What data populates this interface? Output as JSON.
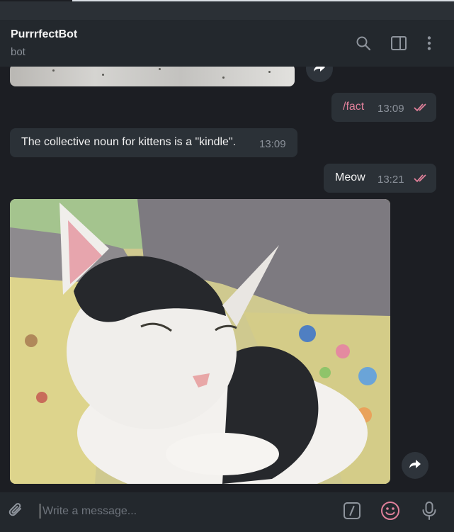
{
  "header": {
    "title": "PurrrfectBot",
    "subtitle": "bot"
  },
  "messages": [
    {
      "kind": "outgoing",
      "text": "/fact",
      "time": "13:09",
      "status": "read"
    },
    {
      "kind": "incoming",
      "text": "The collective noun for kittens is a \"kindle\".",
      "time": "13:09"
    },
    {
      "kind": "outgoing",
      "text": "Meow",
      "time": "13:21",
      "status": "read"
    }
  ],
  "composer": {
    "placeholder": "Write a message..."
  },
  "icons": {
    "search": "search-icon",
    "sidebar": "sidebar-toggle-icon",
    "menu": "more-vertical-icon",
    "forward": "forward-arrow-icon",
    "attach": "paperclip-icon",
    "commands": "bot-commands-icon",
    "emoji": "emoji-icon",
    "voice": "microphone-icon",
    "read": "double-check-icon"
  },
  "colors": {
    "background": "#1c1e23",
    "header": "#23282d",
    "bubble": "#2b3137",
    "command_link": "#e0809a",
    "read_ticks": "#e0809a",
    "emoji_accent": "#e0809a"
  }
}
